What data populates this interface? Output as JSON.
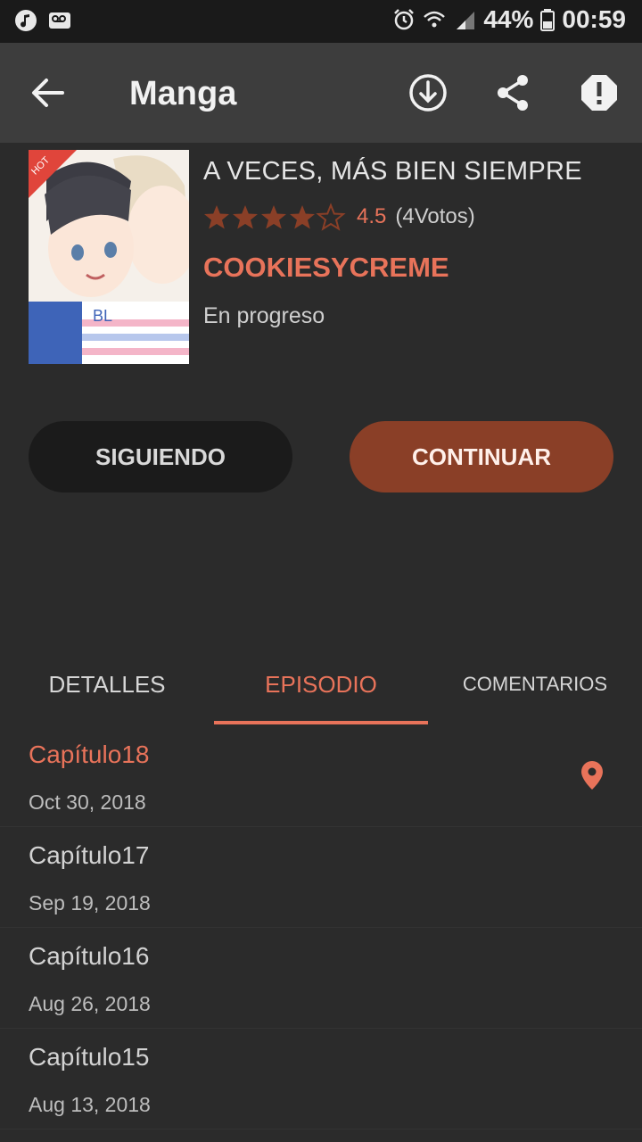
{
  "status_bar": {
    "battery": "44%",
    "time": "00:59",
    "icons": [
      "music-icon",
      "voicemail-icon",
      "alarm-icon",
      "wifi-icon",
      "signal-icon",
      "battery-icon"
    ]
  },
  "app_bar": {
    "title": "Manga",
    "actions": [
      "download-icon",
      "share-icon",
      "report-icon"
    ]
  },
  "manga": {
    "badge": "HOT",
    "title": "A VECES, MÁS BIEN SIEMPRE",
    "rating": "4.5",
    "rating_value": 4.5,
    "rating_max": 5,
    "votes": "(4Votos)",
    "author": "COOKIESYCREME",
    "status": "En progreso"
  },
  "buttons": {
    "following": "SIGUIENDO",
    "continue": "CONTINUAR"
  },
  "tabs": {
    "details": "DETALLES",
    "episode": "EPISODIO",
    "comments": "COMENTARIOS",
    "selected": "EPISODIO"
  },
  "episodes": [
    {
      "name": "Capítulo18",
      "date": "Oct 30, 2018",
      "current": true
    },
    {
      "name": "Capítulo17",
      "date": "Sep 19, 2018"
    },
    {
      "name": "Capítulo16",
      "date": "Aug 26, 2018"
    },
    {
      "name": "Capítulo15",
      "date": "Aug 13, 2018"
    }
  ],
  "colors": {
    "accent": "#e8735a",
    "continue_button": "#8a3f27",
    "star_fill": "#8a3f27",
    "appbar": "#3d3d3d",
    "background": "#2b2b2b"
  }
}
